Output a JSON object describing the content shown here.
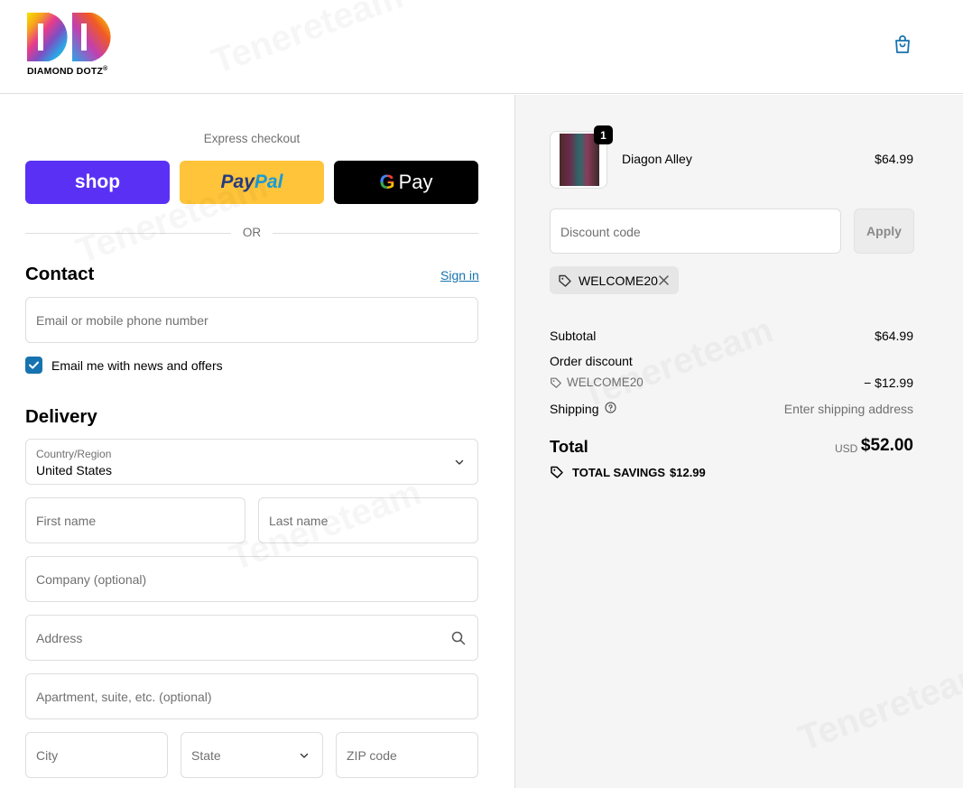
{
  "brand": {
    "name": "DIAMOND DOTZ",
    "trademark": "®"
  },
  "express": {
    "label": "Express checkout",
    "shop_label": "shop",
    "paypal_part1": "Pay",
    "paypal_part2": "Pal",
    "gpay_g": "G",
    "gpay_label": "Pay",
    "or_label": "OR"
  },
  "contact": {
    "title": "Contact",
    "sign_in": "Sign in",
    "email_placeholder": "Email or mobile phone number",
    "newsletter_label": "Email me with news and offers",
    "newsletter_checked": true
  },
  "delivery": {
    "title": "Delivery",
    "country_label": "Country/Region",
    "country_value": "United States",
    "first_name": "First name",
    "last_name": "Last name",
    "company": "Company (optional)",
    "address": "Address",
    "apartment": "Apartment, suite, etc. (optional)",
    "city": "City",
    "state": "State",
    "zip": "ZIP code"
  },
  "summary": {
    "item": {
      "name": "Diagon Alley",
      "price": "$64.99",
      "quantity": "1"
    },
    "discount_placeholder": "Discount code",
    "apply_label": "Apply",
    "applied_code": "WELCOME20",
    "subtotal_label": "Subtotal",
    "subtotal_value": "$64.99",
    "order_discount_label": "Order discount",
    "discount_code": "WELCOME20",
    "discount_value": "− $12.99",
    "shipping_label": "Shipping",
    "shipping_value": "Enter shipping address",
    "total_label": "Total",
    "currency": "USD",
    "total_value": "$52.00",
    "savings_label": "TOTAL SAVINGS",
    "savings_value": "$12.99"
  },
  "colors": {
    "accent": "#1773b0",
    "shop": "#5a31f4",
    "paypal": "#ffc439",
    "gpay": "#000000"
  },
  "watermark": "Tenereteam"
}
